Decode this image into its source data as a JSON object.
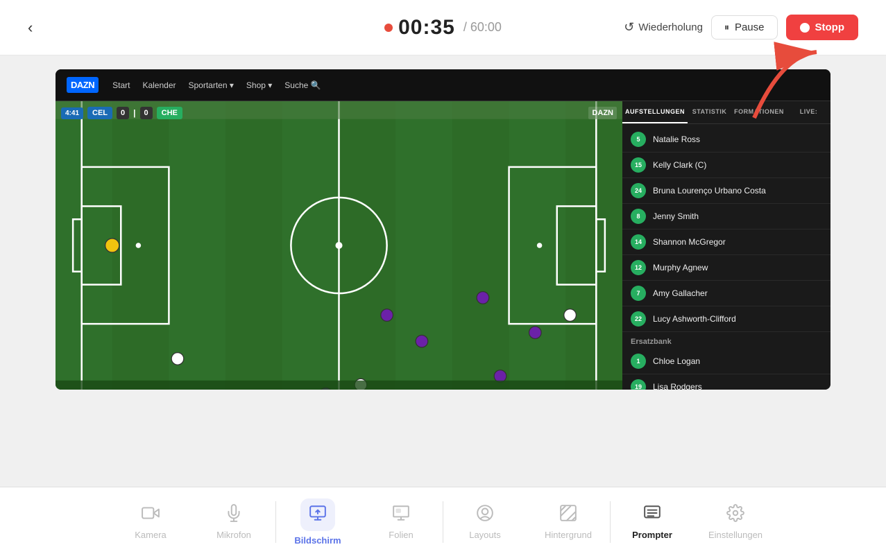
{
  "topbar": {
    "back_label": "‹",
    "timer": "00:35",
    "timer_sep": "/ 60:00",
    "replay_label": "Wiederholung",
    "pause_label": "Pause",
    "stop_label": "Stopp"
  },
  "dazn": {
    "logo": "DAZN",
    "nav": [
      "Start",
      "Kalender",
      "Sportarten",
      "Shop",
      "Suche"
    ],
    "nav_dropdowns": [
      "Sportarten",
      "Shop"
    ],
    "score": {
      "time": "4:41",
      "team1": "CEL",
      "goals1": "0",
      "goals2": "0",
      "team2": "CHE"
    },
    "watermark": "DAZN"
  },
  "sidebar": {
    "tabs": [
      "AUFSTELLUNGEN",
      "STATISTIK",
      "FORMATIONEN",
      "LIVE:"
    ],
    "active_tab": "AUFSTELLUNGEN",
    "players": [
      {
        "number": "5",
        "name": "Natalie Ross"
      },
      {
        "number": "15",
        "name": "Kelly Clark (C)"
      },
      {
        "number": "24",
        "name": "Bruna Lourenço Urbano Costa"
      },
      {
        "number": "8",
        "name": "Jenny Smith"
      },
      {
        "number": "14",
        "name": "Shannon McGregor"
      },
      {
        "number": "12",
        "name": "Murphy Agnew"
      },
      {
        "number": "7",
        "name": "Amy Gallacher"
      },
      {
        "number": "22",
        "name": "Lucy Ashworth-Clifford"
      }
    ],
    "bench_label": "Ersatzbank",
    "bench_players": [
      {
        "number": "1",
        "name": "Chloe Logan"
      },
      {
        "number": "19",
        "name": "Lisa Rodgers"
      }
    ]
  },
  "toolbar": {
    "items": [
      {
        "id": "kamera",
        "label": "Kamera",
        "icon": "camera",
        "active": false,
        "bold": false
      },
      {
        "id": "mikrofon",
        "label": "Mikrofon",
        "icon": "mic",
        "active": false,
        "bold": false
      },
      {
        "id": "bildschirm",
        "label": "Bildschirm",
        "icon": "screen",
        "active": true,
        "bold": false
      },
      {
        "id": "folien",
        "label": "Folien",
        "icon": "slides",
        "active": false,
        "bold": false
      },
      {
        "id": "layouts",
        "label": "Layouts",
        "icon": "layouts",
        "active": false,
        "bold": false
      },
      {
        "id": "hintergrund",
        "label": "Hintergrund",
        "icon": "background",
        "active": false,
        "bold": false
      },
      {
        "id": "prompter",
        "label": "Prompter",
        "icon": "prompter",
        "active": false,
        "bold": true
      },
      {
        "id": "einstellungen",
        "label": "Einstellungen",
        "icon": "settings",
        "active": false,
        "bold": false
      }
    ]
  }
}
